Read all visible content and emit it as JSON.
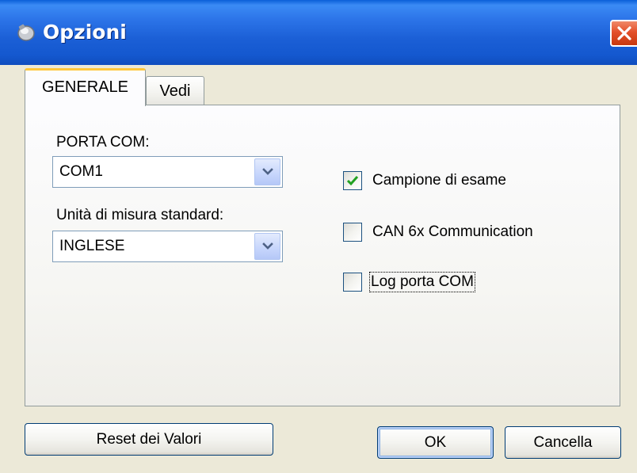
{
  "window": {
    "title": "Opzioni",
    "icon": "app-icon"
  },
  "tabs": [
    {
      "label": "GENERALE",
      "selected": true
    },
    {
      "label": "Vedi",
      "selected": false
    }
  ],
  "general": {
    "com_port_label": "PORTA COM:",
    "com_port_value": "COM1",
    "units_label": "Unità di misura standard:",
    "units_value": "INGLESE",
    "checkboxes": [
      {
        "label": "Campione di esame",
        "checked": true
      },
      {
        "label": "CAN 6x Communication",
        "checked": false
      },
      {
        "label": "Log porta COM",
        "checked": false,
        "focused": true
      }
    ]
  },
  "buttons": {
    "reset": "Reset dei Valori",
    "ok": "OK",
    "cancel": "Cancella"
  },
  "colors": {
    "titlebar": "#1B5FD6",
    "window_bg": "#ECE9D8",
    "close": "#E3502A",
    "tab_highlight": "#FFC83C",
    "check_mark": "#21A121"
  }
}
